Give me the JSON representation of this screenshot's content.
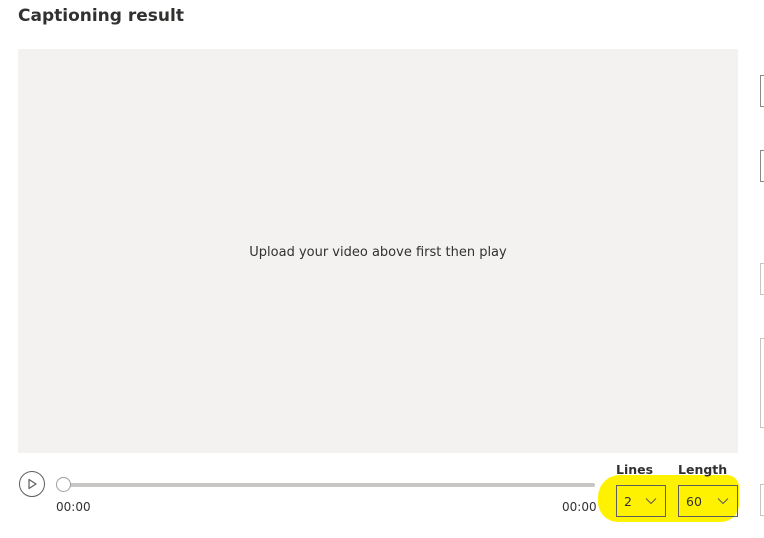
{
  "header": {
    "title": "Captioning result"
  },
  "video": {
    "placeholder_message": "Upload your video above first then play"
  },
  "player": {
    "current_time": "00:00",
    "duration": "00:00",
    "progress": 0
  },
  "caption_settings": {
    "lines_label": "Lines",
    "lines_value": "2",
    "length_label": "Length",
    "length_value": "60"
  },
  "colors": {
    "highlight": "#fff200",
    "video_background": "#f3f2f1",
    "text": "#323130"
  }
}
